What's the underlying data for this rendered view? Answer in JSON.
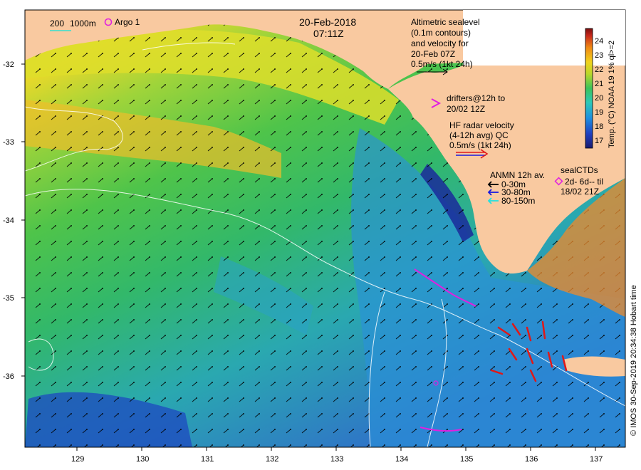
{
  "title": {
    "date": "20-Feb-2018",
    "time": "07:11Z"
  },
  "top_legend": {
    "scale_200": "200",
    "scale_1000": "1000m",
    "argo": "Argo 1"
  },
  "altimetry": {
    "line1": "Altimetric sealevel",
    "line2": "(0.1m contours)",
    "line3": "and velocity for",
    "line4": "20-Feb 07Z",
    "line5": "0.5m/s (1kt 24h)"
  },
  "drifters": {
    "line1": "drifters@12h to",
    "line2": "20/02 12Z"
  },
  "hf_radar": {
    "line1": "HF radar velocity",
    "line2": "(4-12h avg) QC",
    "line3": "0.5m/s (1kt 24h)"
  },
  "anmn": {
    "title": "ANMN 12h av.",
    "l1": "0-30m",
    "l2": "30-80m",
    "l3": "80-150m"
  },
  "seal": {
    "title": "sealCTDs",
    "l1": "2d- 6d-- til",
    "l2": "18/02 21Z"
  },
  "colorbar": {
    "label": "Temp. (°C) NOAA 19 1% ql>=2",
    "ticks": [
      "24",
      "23",
      "22",
      "21",
      "20",
      "19",
      "18",
      "17"
    ]
  },
  "lat_ticks": [
    "-32",
    "-33",
    "-34",
    "-35",
    "-36"
  ],
  "lon_ticks": [
    "129",
    "130",
    "131",
    "132",
    "133",
    "134",
    "135",
    "136",
    "137"
  ],
  "credit": "© IMOS 30-Sep-2019 20:34:38 Hobart time",
  "colors": {
    "land": "#f9c9a0",
    "legend_white": "#ffffff"
  }
}
